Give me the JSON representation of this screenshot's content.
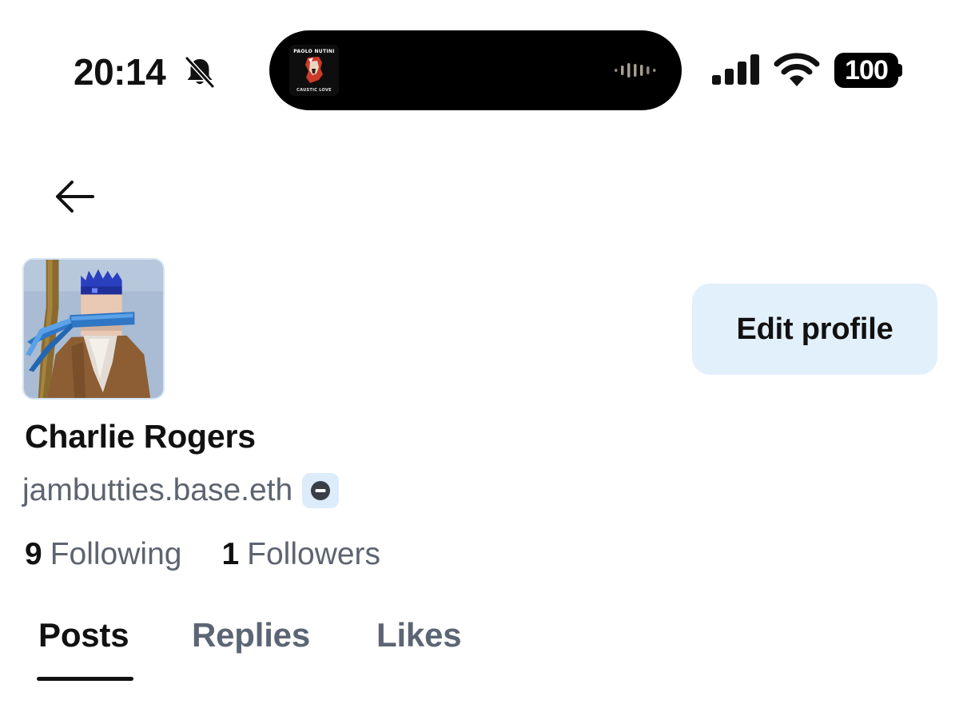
{
  "status_bar": {
    "time": "20:14",
    "battery": "100",
    "icons": [
      "bell-slash-icon",
      "waveform-icon",
      "signal-icon",
      "wifi-icon",
      "battery-icon"
    ]
  },
  "now_playing": {
    "artist": "PAOLO NUTINI",
    "album": "CAUSTIC LOVE"
  },
  "header": {
    "back_icon": "arrow-left-icon"
  },
  "profile": {
    "display_name": "Charlie Rogers",
    "handle": "jambutties.base.eth",
    "badge_icon": "minus-circle-icon",
    "edit_button": "Edit profile",
    "following_count": "9",
    "following_label": "Following",
    "followers_count": "1",
    "followers_label": "Followers"
  },
  "tabs": [
    {
      "label": "Posts",
      "active": true
    },
    {
      "label": "Replies",
      "active": false
    },
    {
      "label": "Likes",
      "active": false
    }
  ],
  "colors": {
    "accent_bg": "#e2f0fc",
    "text_primary": "#111111",
    "text_secondary": "#5d6470"
  }
}
